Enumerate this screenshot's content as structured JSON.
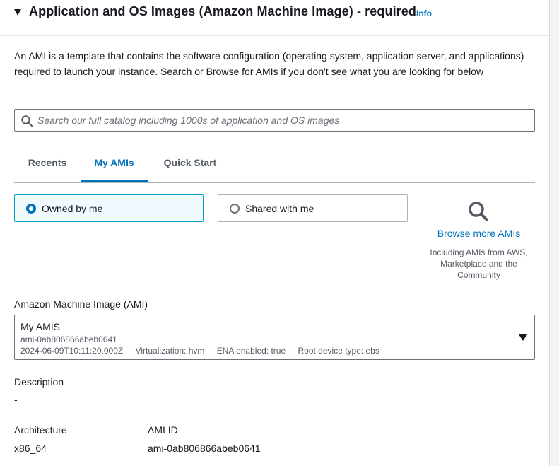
{
  "section": {
    "title": "Application and OS Images (Amazon Machine Image) - required",
    "info": "Info",
    "description": "An AMI is a template that contains the software configuration (operating system, application server, and applications) required to launch your instance. Search or Browse for AMIs if you don't see what you are looking for below"
  },
  "search": {
    "placeholder": "Search our full catalog including 1000s of application and OS images",
    "value": ""
  },
  "tabs": [
    {
      "label": "Recents",
      "active": false
    },
    {
      "label": "My AMIs",
      "active": true
    },
    {
      "label": "Quick Start",
      "active": false
    }
  ],
  "ownership": {
    "options": [
      {
        "label": "Owned by me",
        "selected": true
      },
      {
        "label": "Shared with me",
        "selected": false
      }
    ]
  },
  "browse": {
    "link": "Browse more AMIs",
    "sub": "Including AMIs from AWS, Marketplace and the Community"
  },
  "ami_select": {
    "label": "Amazon Machine Image (AMI)",
    "name": "My AMIS",
    "id": "ami-0ab806866abeb0641",
    "created": "2024-06-09T10:11:20.000Z",
    "virtualization": "Virtualization: hvm",
    "ena": "ENA enabled: true",
    "root_device": "Root device type: ebs"
  },
  "details": {
    "description_label": "Description",
    "description_value": "-",
    "architecture_label": "Architecture",
    "architecture_value": "x86_64",
    "ami_id_label": "AMI ID",
    "ami_id_value": "ami-0ab806866abeb0641"
  },
  "colors": {
    "link": "#0073bb",
    "selected_bg": "#f1faff",
    "selected_border": "#00a1c9"
  },
  "icons": {
    "caret": "caret-down-icon",
    "search": "search-icon",
    "browse": "magnifier-icon",
    "dropdown": "chevron-down-icon"
  }
}
